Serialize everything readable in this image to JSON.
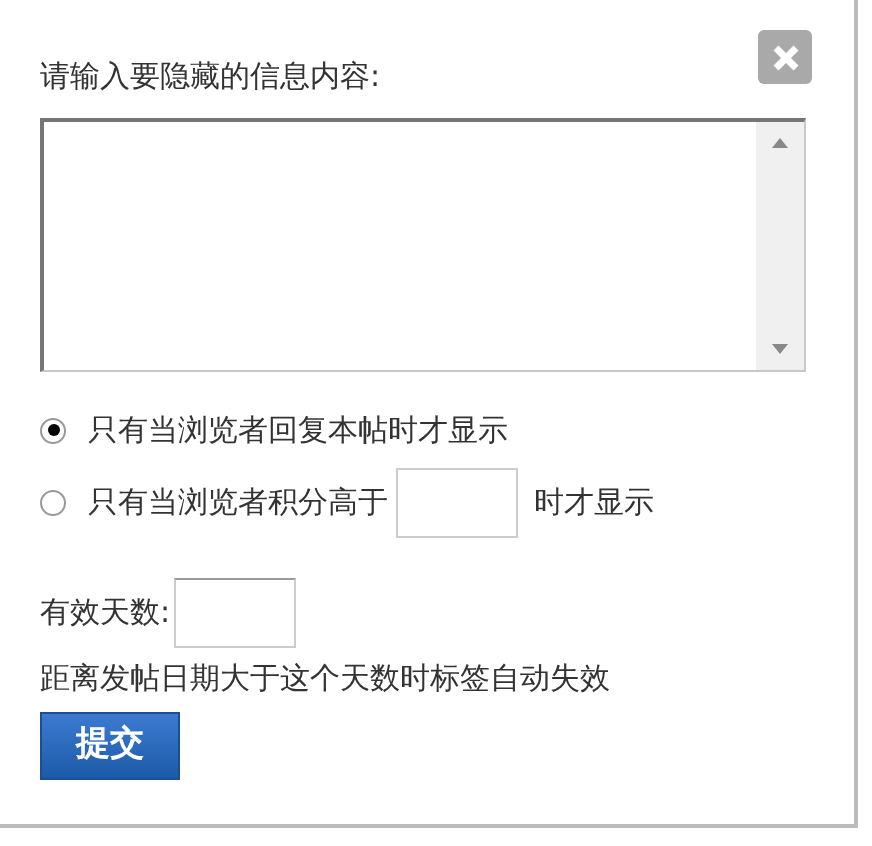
{
  "prompt": "请输入要隐藏的信息内容:",
  "options": [
    {
      "kind": "plain",
      "label": "只有当浏览者回复本帖时才显示",
      "selected": true
    },
    {
      "kind": "score",
      "label": "只有当浏览者积分高于",
      "suffix": "时才显示",
      "selected": false
    }
  ],
  "days_label": "有效天数:",
  "days_note": "距离发帖日期大于这个天数时标签自动失效",
  "submit": "提交"
}
